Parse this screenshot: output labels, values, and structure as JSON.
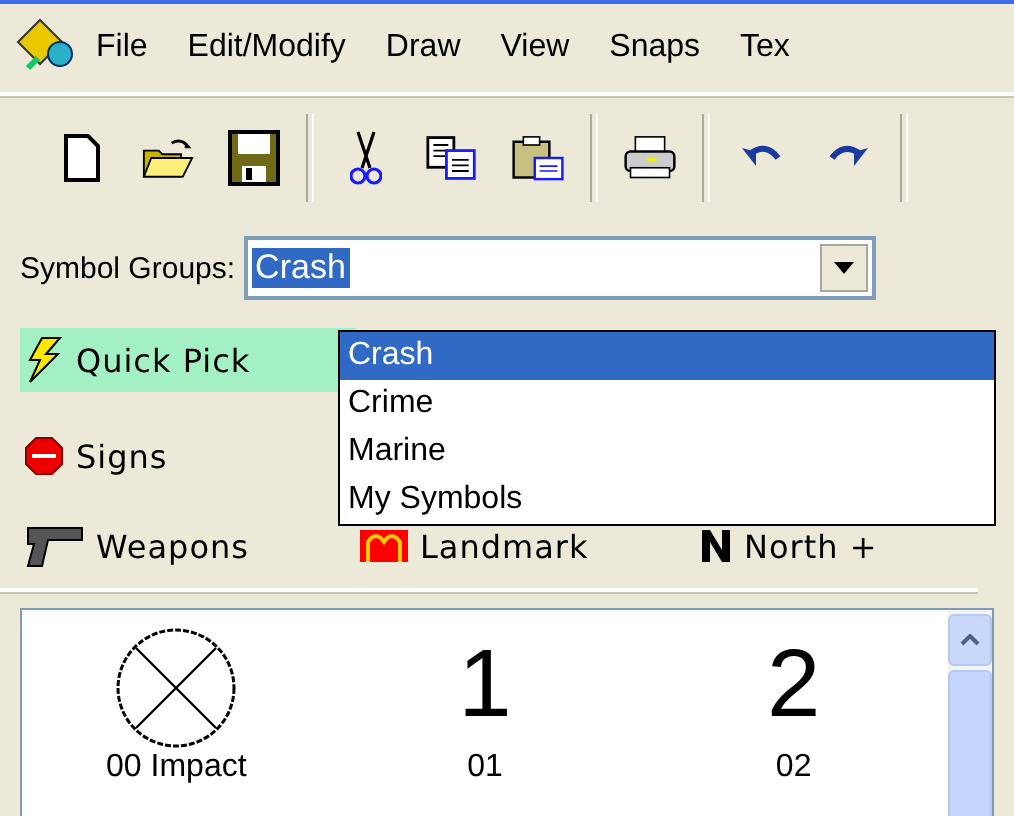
{
  "menu": [
    "File",
    "Edit/Modify",
    "Draw",
    "View",
    "Snaps",
    "Tex"
  ],
  "toolbar": [
    {
      "kind": "new"
    },
    {
      "kind": "open"
    },
    {
      "kind": "save"
    },
    {
      "kind": "separator"
    },
    {
      "kind": "cut"
    },
    {
      "kind": "copy"
    },
    {
      "kind": "paste"
    },
    {
      "kind": "separator"
    },
    {
      "kind": "print"
    },
    {
      "kind": "separator"
    },
    {
      "kind": "undo"
    },
    {
      "kind": "redo"
    },
    {
      "kind": "separator"
    }
  ],
  "symbol_groups": {
    "label": "Symbol Groups:",
    "value": "Crash",
    "options": [
      {
        "label": "Crash",
        "selected": true
      },
      {
        "label": "Crime",
        "selected": false
      },
      {
        "label": "Marine",
        "selected": false
      },
      {
        "label": "My Symbols",
        "selected": false
      }
    ]
  },
  "categories": [
    {
      "kind": "bolt",
      "label": "Quick Pick",
      "selected": true
    },
    {
      "kind": "none"
    },
    {
      "kind": "none"
    },
    {
      "kind": "stop",
      "label": "Signs",
      "selected": false
    },
    {
      "kind": "none"
    },
    {
      "kind": "none"
    },
    {
      "kind": "gun",
      "label": "Weapons",
      "selected": false
    },
    {
      "kind": "landmark",
      "label": "Landmark",
      "selected": false
    },
    {
      "kind": "north",
      "label": "North +",
      "selected": false
    }
  ],
  "symbols": [
    {
      "kind": "impact",
      "label": "00 Impact"
    },
    {
      "kind": "digit",
      "glyph": "1",
      "label": "01"
    },
    {
      "kind": "digit",
      "glyph": "2",
      "label": "02"
    }
  ]
}
